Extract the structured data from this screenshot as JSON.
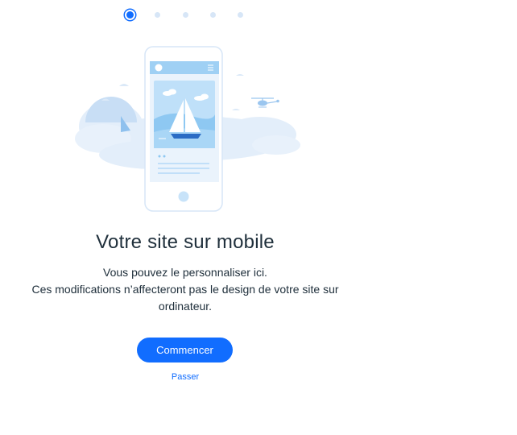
{
  "onboarding": {
    "steps": [
      {
        "state": "active"
      },
      {
        "state": "inactive"
      },
      {
        "state": "inactive"
      },
      {
        "state": "inactive"
      },
      {
        "state": "inactive"
      }
    ],
    "illustration": "mobile-phone-sailboat-illustration",
    "title": "Votre site sur mobile",
    "description_line1": "Vous pouvez le personnaliser ici.",
    "description_line2": "Ces modifications n’affecteront pas le design de votre site sur",
    "description_line3": "ordinateur.",
    "start_button": "Commencer",
    "skip_link": "Passer"
  },
  "colors": {
    "accent": "#116dff",
    "text": "#20303c",
    "illustration_light": "#d7e6f7",
    "illustration_mid": "#a9d3f7"
  }
}
